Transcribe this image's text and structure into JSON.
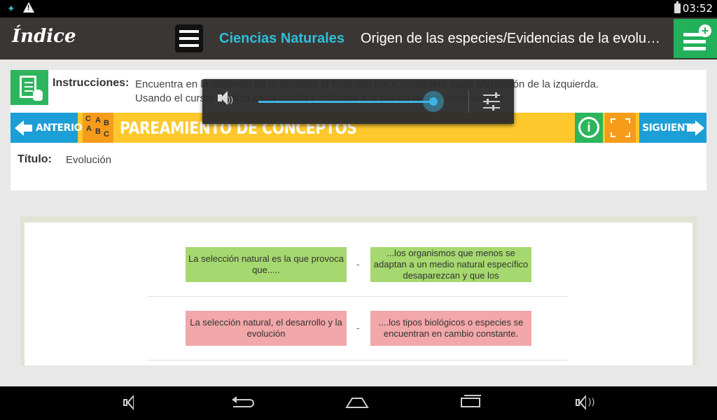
{
  "status_bar": {
    "time": "03:52"
  },
  "header": {
    "index_title": "Índice",
    "subject": "Ciencias Naturales",
    "topic": "Origen de las especies/Evidencias de la evolución"
  },
  "instructions": {
    "label": "Instrucciones:",
    "line1": "Encuentra en la columna de la derecha el final que hace verdadera cada afirmación de la izquierda.",
    "line2": "Usando el cursor desliza cada casilla y colócala a la par de la que corresponde."
  },
  "activity_bar": {
    "prev_label": "ANTERIOR",
    "abc_letters": [
      "C",
      "A",
      "B",
      "A",
      "B",
      "C"
    ],
    "title": "PAREAMIENTO DE CONCEPTOS",
    "info_symbol": "i",
    "next_label": "SIGUIENTE"
  },
  "title_row": {
    "label": "Título:",
    "value": "Evolución"
  },
  "pairs": [
    {
      "left": "La selección natural es la que provoca que.....",
      "separator": "-",
      "right": "...los organismos que menos se adaptan a un medio natural específico desaparezcan  y que los",
      "state": "correct"
    },
    {
      "left": "La selección natural, el desarrollo y la evolución",
      "separator": "-",
      "right": "....los tipos biológicos o especies se encuentran en cambio constante.",
      "state": "incorrect"
    }
  ],
  "volume_popup": {
    "level_percent": 100
  },
  "colors": {
    "header_bg": "#3a3634",
    "subject_text": "#2cc0d8",
    "add_button": "#22b05a",
    "nav_blue": "#1c9ed6",
    "activity_yellow": "#fec82d",
    "accent_orange": "#f59c1a",
    "correct_green": "#a5d86e",
    "incorrect_red": "#f2a7a8",
    "volume_accent": "#33b5e5"
  },
  "icons": {
    "header_menu": "list-icon",
    "header_add": "add-list-icon",
    "instructions": "document-touch-icon",
    "prev": "arrow-left-icon",
    "abc": "abc-icon",
    "info": "info-speech-icon",
    "expand": "expand-icon",
    "next": "arrow-right-icon",
    "volume": "speaker-icon",
    "volume_settings": "sliders-icon",
    "nav_vol_down": "volume-down-icon",
    "nav_back": "back-icon",
    "nav_home": "home-icon",
    "nav_recent": "recent-apps-icon",
    "nav_vol_up": "volume-up-icon"
  }
}
